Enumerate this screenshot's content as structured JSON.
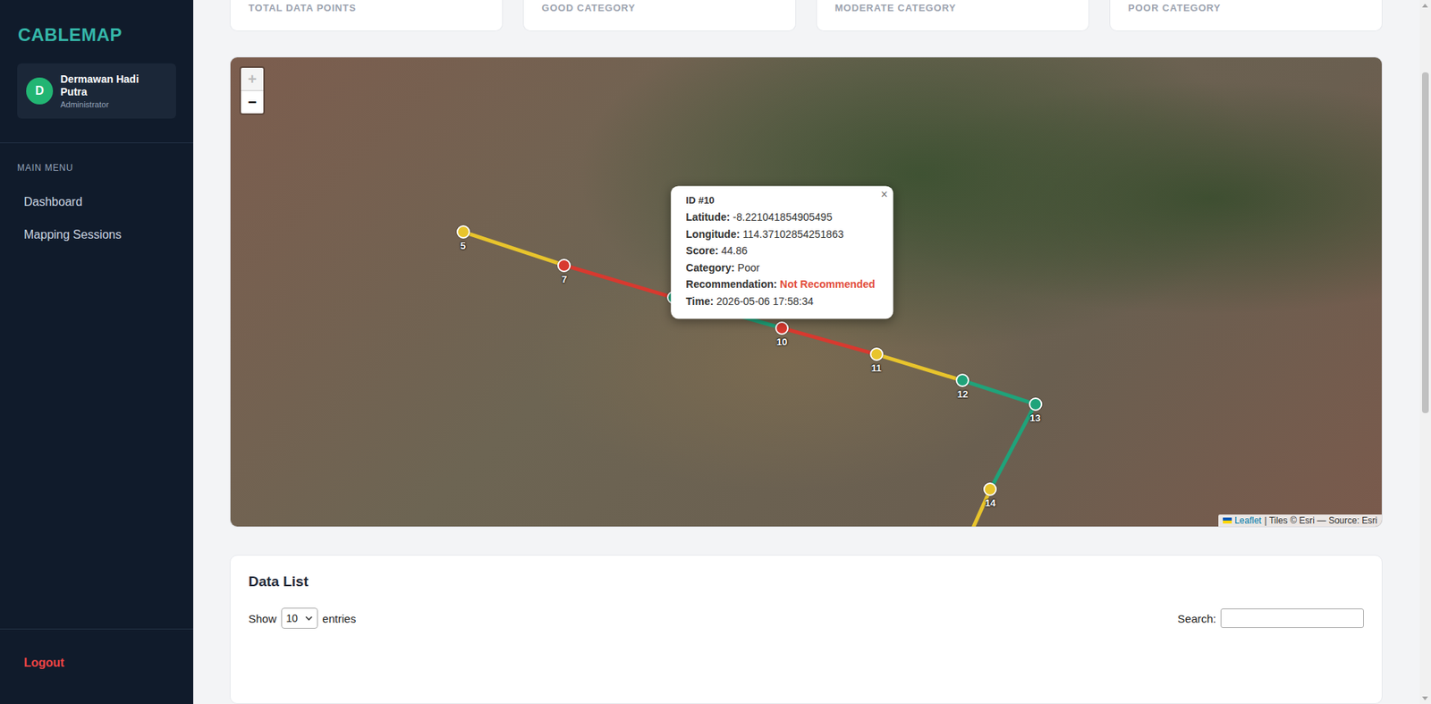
{
  "sidebar": {
    "logo": "CABLEMAP",
    "user": {
      "initial": "D",
      "name": "Dermawan Hadi Putra",
      "role": "Administrator"
    },
    "menu_title": "MAIN MENU",
    "items": [
      {
        "label": "Dashboard",
        "selected": false
      },
      {
        "label": "Mapping Sessions",
        "selected": false
      }
    ],
    "logout": "Logout"
  },
  "stats": [
    {
      "label": "TOTAL DATA POINTS"
    },
    {
      "label": "GOOD CATEGORY"
    },
    {
      "label": "MODERATE CATEGORY"
    },
    {
      "label": "POOR CATEGORY"
    }
  ],
  "map": {
    "zoom_in": {
      "label": "+",
      "disabled": true
    },
    "zoom_out": {
      "label": "−",
      "disabled": false
    },
    "points": [
      {
        "label": "5",
        "color": "#e8c42c",
        "selected": false
      },
      {
        "label": "7",
        "color": "#d8392f",
        "selected": false
      },
      {
        "label": "",
        "color": "#1fa37a",
        "selected": false
      },
      {
        "label": "10",
        "color": "#d8392f",
        "selected": true
      },
      {
        "label": "11",
        "color": "#e8c42c",
        "selected": false
      },
      {
        "label": "12",
        "color": "#1fa37a",
        "selected": false
      },
      {
        "label": "13",
        "color": "#1fa37a",
        "selected": false
      },
      {
        "label": "14",
        "color": "#e8c42c",
        "selected": false
      }
    ],
    "popup": {
      "title": "ID #10",
      "close": "×",
      "fields": [
        {
          "label": "Latitude:",
          "value": "-8.221041854905495",
          "kind": "plain"
        },
        {
          "label": "Longitude:",
          "value": "114.37102854251863",
          "kind": "plain"
        },
        {
          "label": "Score:",
          "value": "44.86",
          "kind": "plain"
        },
        {
          "label": "Category:",
          "value": "Poor",
          "kind": "plain"
        },
        {
          "label": "Recommendation:",
          "value": "Not Recommended",
          "kind": "alert"
        },
        {
          "label": "Time:",
          "value": "2026-05-06 17:58:34",
          "kind": "plain"
        }
      ]
    },
    "attribution": {
      "link": "Leaflet",
      "text": "| Tiles © Esri — Source: Esri"
    }
  },
  "data_list": {
    "title": "Data List",
    "show_label": "Show",
    "page_size": "10",
    "entries_label": "entries",
    "search_label": "Search:",
    "search_value": ""
  },
  "scrollbar": {
    "offset": 0.09,
    "size": 0.5
  }
}
